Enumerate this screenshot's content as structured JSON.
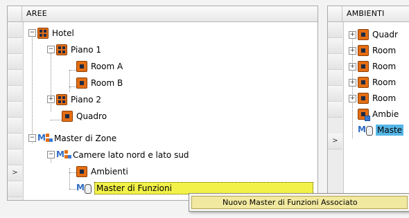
{
  "left_panel": {
    "header": "AREE",
    "gutter_marker": ">",
    "tree": [
      {
        "label": "Hotel"
      },
      {
        "label": "Piano 1"
      },
      {
        "label": "Room A"
      },
      {
        "label": "Room B"
      },
      {
        "label": "Piano 2"
      },
      {
        "label": "Quadro"
      },
      {
        "label": "Master di Zone"
      },
      {
        "label": "Camere lato nord e lato sud"
      },
      {
        "label": "Ambienti"
      },
      {
        "label": "Master di Funzioni"
      }
    ],
    "icons": [
      "area-grid-icon",
      "area-grid-icon",
      "room-icon",
      "room-icon",
      "area-grid-icon",
      "room-icon",
      "master-zone-icon",
      "master-zone-icon",
      "room-icon",
      "master-function-icon"
    ]
  },
  "right_panel": {
    "header": "AMBIENTI",
    "gutter_marker": ">",
    "tree": [
      {
        "label": "Quadr"
      },
      {
        "label": "Room"
      },
      {
        "label": "Room"
      },
      {
        "label": "Room"
      },
      {
        "label": "Room"
      },
      {
        "label": "Ambie"
      },
      {
        "label": "Maste"
      }
    ]
  },
  "context_menu": {
    "item_label": "Nuovo Master di Funzioni Associato"
  },
  "colors": {
    "selection_yellow": "#f1f149",
    "selection_blue": "#55b6e6",
    "icon_orange": "#e46e13",
    "menu_highlight": "#f2e9a0"
  }
}
